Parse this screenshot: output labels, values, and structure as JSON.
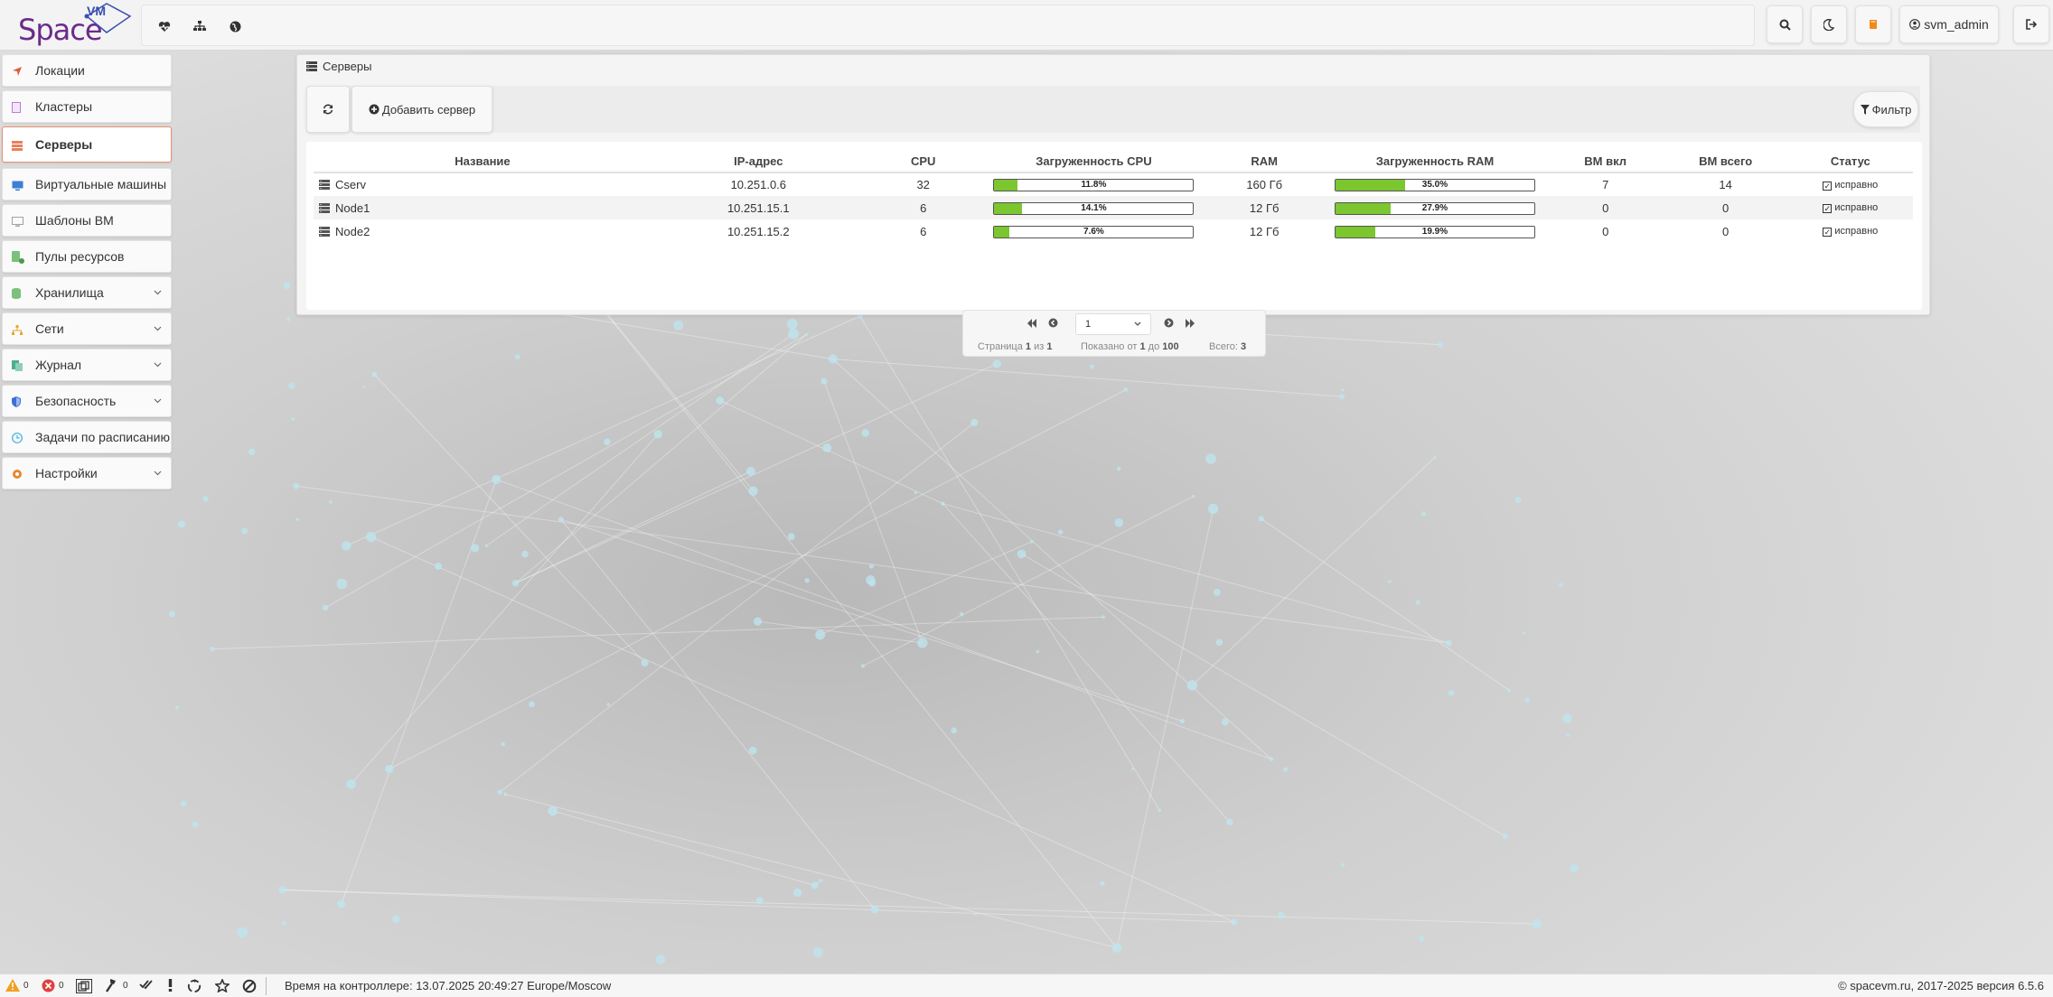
{
  "app": {
    "logo_text": "Space",
    "logo_sub": "VM"
  },
  "topbar": {
    "user": "svm_admin"
  },
  "sidebar": {
    "items": [
      {
        "label": "Локации",
        "icon": "location-arrow-icon",
        "color": "#e05a3a",
        "expandable": false
      },
      {
        "label": "Кластеры",
        "icon": "cluster-icon",
        "color": "#b87fd6",
        "expandable": false
      },
      {
        "label": "Серверы",
        "icon": "server-icon",
        "color": "#e8805b",
        "expandable": false,
        "active": true
      },
      {
        "label": "Виртуальные машины",
        "icon": "monitor-icon",
        "color": "#3b7fd6",
        "expandable": false
      },
      {
        "label": "Шаблоны ВМ",
        "icon": "template-icon",
        "color": "#9aa3ad",
        "expandable": false
      },
      {
        "label": "Пулы ресурсов",
        "icon": "resource-pool-icon",
        "color": "#7bc07b",
        "expandable": false
      },
      {
        "label": "Хранилища",
        "icon": "storage-icon",
        "color": "#7bc07b",
        "expandable": true
      },
      {
        "label": "Сети",
        "icon": "network-icon",
        "color": "#e5a72d",
        "expandable": true
      },
      {
        "label": "Журнал",
        "icon": "journal-icon",
        "color": "#4bb08a",
        "expandable": true
      },
      {
        "label": "Безопасность",
        "icon": "shield-icon",
        "color": "#3b6fd6",
        "expandable": true
      },
      {
        "label": "Задачи по расписанию",
        "icon": "clock-icon",
        "color": "#3bb0e0",
        "expandable": false
      },
      {
        "label": "Настройки",
        "icon": "gear-icon",
        "color": "#e5882d",
        "expandable": true
      }
    ]
  },
  "panel": {
    "title": "Серверы",
    "add_label": "Добавить сервер",
    "filter_label": "Фильтр"
  },
  "table": {
    "columns": [
      "Название",
      "IP-адрес",
      "CPU",
      "Загруженность CPU",
      "RAM",
      "Загруженность RAM",
      "ВМ вкл",
      "ВМ всего",
      "Статус"
    ],
    "rows": [
      {
        "name": "Cserv",
        "ip": "10.251.0.6",
        "cpu": "32",
        "cpu_load": "11.8%",
        "cpu_pct": 11.8,
        "ram": "160 Гб",
        "ram_load": "35.0%",
        "ram_pct": 35.0,
        "vm_on": "7",
        "vm_total": "14",
        "status": "исправно"
      },
      {
        "name": "Node1",
        "ip": "10.251.15.1",
        "cpu": "6",
        "cpu_load": "14.1%",
        "cpu_pct": 14.1,
        "ram": "12 Гб",
        "ram_load": "27.9%",
        "ram_pct": 27.9,
        "vm_on": "0",
        "vm_total": "0",
        "status": "исправно"
      },
      {
        "name": "Node2",
        "ip": "10.251.15.2",
        "cpu": "6",
        "cpu_load": "7.6%",
        "cpu_pct": 7.6,
        "ram": "12 Гб",
        "ram_load": "19.9%",
        "ram_pct": 19.9,
        "vm_on": "0",
        "vm_total": "0",
        "status": "исправно"
      }
    ]
  },
  "pager": {
    "current": "1",
    "page_label": "Страница",
    "page_of": "из",
    "page_current": "1",
    "page_total": "1",
    "shown_label": "Показано от",
    "shown_from": "1",
    "shown_to_label": "до",
    "shown_to": "100",
    "total_label": "Всего:",
    "total": "3"
  },
  "footer": {
    "warnings": "0",
    "errors": "0",
    "tasks": "0",
    "controller_time": "Время на контроллере: 13.07.2025 20:49:27 Europe/Moscow",
    "copyright": "© spacevm.ru, 2017-2025 версия 6.5.6"
  },
  "colors": {
    "accent": "#e8916d",
    "bar_fill": "#7cc62f",
    "warning": "#f0a020",
    "error": "#e04040"
  }
}
